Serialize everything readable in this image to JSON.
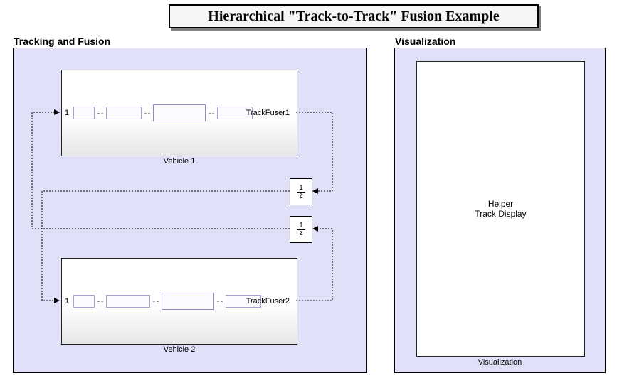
{
  "title": "Hierarchical \"Track-to-Track\" Fusion Example",
  "panels": {
    "tracking": {
      "label": "Tracking and Fusion"
    },
    "viz": {
      "label": "Visualization"
    }
  },
  "vehicles": [
    {
      "label": "Vehicle 1",
      "port": "1",
      "fuser": "TrackFuser1"
    },
    {
      "label": "Vehicle 2",
      "port": "1",
      "fuser": "TrackFuser2"
    }
  ],
  "delay": {
    "num": "1",
    "den": "z"
  },
  "vizbox": {
    "line1": "Helper",
    "line2": "Track Display",
    "caption": "Visualization"
  }
}
